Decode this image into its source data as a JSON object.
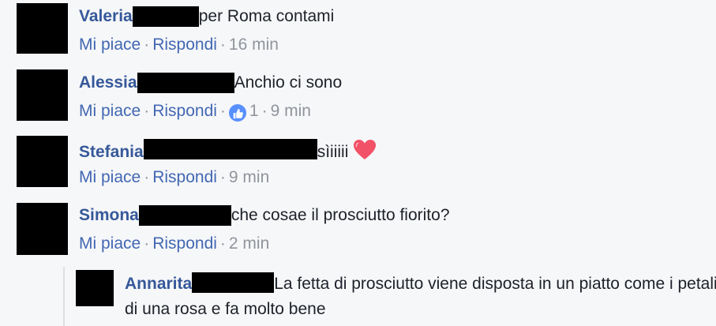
{
  "comments": [
    {
      "author": "Valeria",
      "text": "per Roma contami",
      "like_label": "Mi piace",
      "reply_label": "Rispondi",
      "time": "16 min"
    },
    {
      "author": "Alessia",
      "text": "Anchio ci sono",
      "like_label": "Mi piace",
      "reply_label": "Rispondi",
      "like_count": "1",
      "time": "9 min"
    },
    {
      "author": "Stefania",
      "text": "sìiiiii",
      "like_label": "Mi piace",
      "reply_label": "Rispondi",
      "time": "9 min"
    },
    {
      "author": "Simona",
      "text": "che cosae il prosciutto fiorito?",
      "like_label": "Mi piace",
      "reply_label": "Rispondi",
      "time": "2 min"
    }
  ],
  "reply": {
    "author": "Annarita",
    "text": "La fetta di prosciutto viene disposta in un piatto come i petali di una rosa e fa molto bene"
  },
  "icons": {
    "like_reaction": "thumbs-up-icon",
    "emoji": "heart-icon"
  },
  "colors": {
    "author": "#365899",
    "link": "#4267b2",
    "meta": "#90949c",
    "like_badge": "#5890ff",
    "heart": "#f25268"
  }
}
